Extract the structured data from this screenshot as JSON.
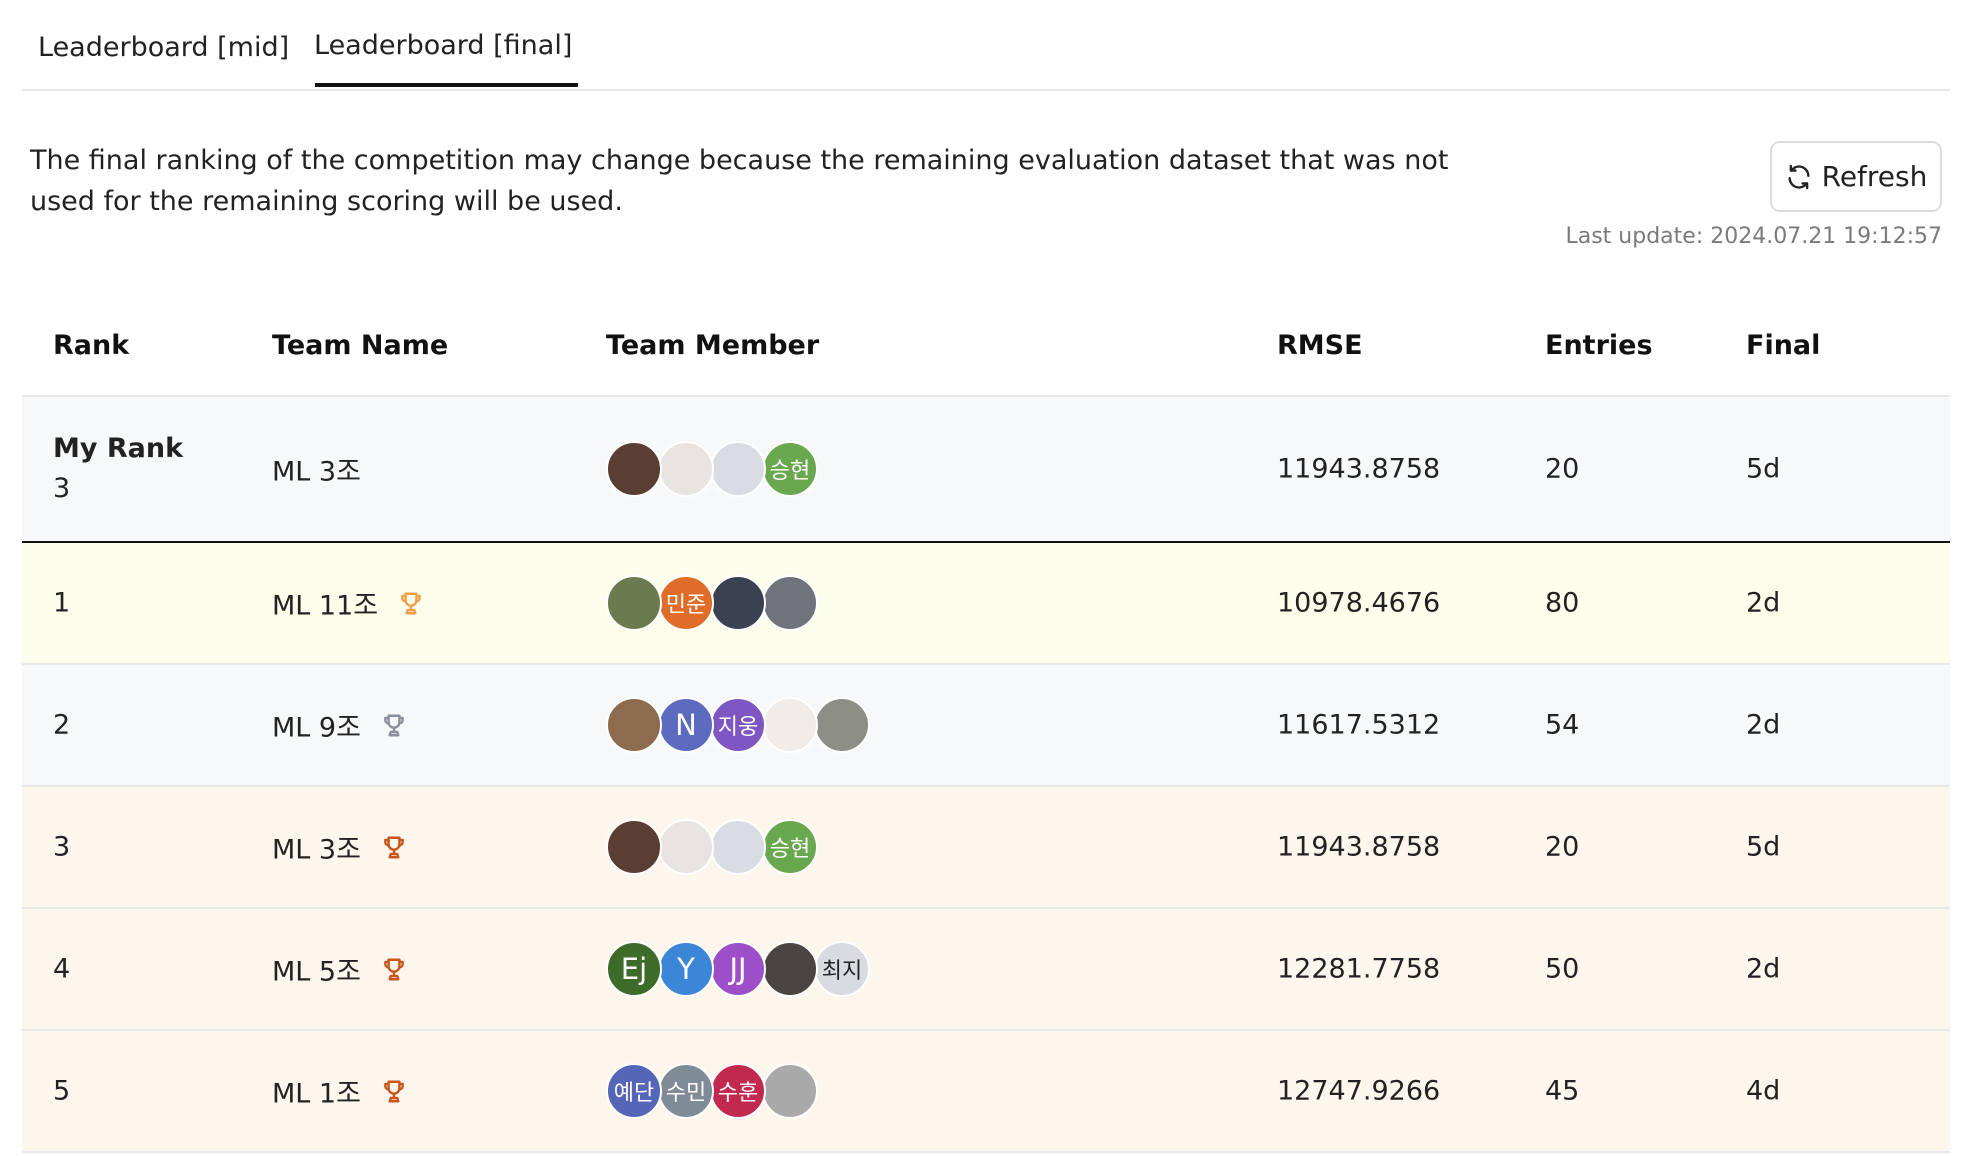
{
  "tabs": [
    {
      "label": "Leaderboard [mid]",
      "active": false
    },
    {
      "label": "Leaderboard [final]",
      "active": true
    }
  ],
  "notice": "The final ranking of the competition may change because the remaining evaluation dataset that was not used for the remaining scoring will be used.",
  "refresh_label": "Refresh",
  "last_update": "Last update: 2024.07.21 19:12:57",
  "table": {
    "headers": [
      "Rank",
      "Team Name",
      "Team Member",
      "RMSE",
      "Entries",
      "Final"
    ],
    "my_rank": {
      "label": "My Rank",
      "rank": "3",
      "team": "ML 3조",
      "rmse": "11943.8758",
      "entries": "20",
      "final": "5d",
      "members": [
        {
          "text": "",
          "color": "#5a3d33",
          "icon": "photo-avatar"
        },
        {
          "text": "",
          "color": "#e8e4e0",
          "icon": "photo-avatar"
        },
        {
          "text": "",
          "color": "#d9dde3",
          "icon": "photo-avatar"
        },
        {
          "text": "승현",
          "color": "#6aa84f"
        }
      ]
    },
    "rows": [
      {
        "rank": "1",
        "team": "ML 11조",
        "trophy_color": "#f0a04b",
        "rmse": "10978.4676",
        "entries": "80",
        "final": "2d",
        "tone": "gold",
        "members": [
          {
            "text": "",
            "color": "#6b7a4f",
            "icon": "photo-avatar"
          },
          {
            "text": "민준",
            "color": "#e06c2a"
          },
          {
            "text": "",
            "color": "#3a4150",
            "icon": "photo-avatar"
          },
          {
            "text": "",
            "color": "#6f747a",
            "icon": "photo-avatar"
          }
        ]
      },
      {
        "rank": "2",
        "team": "ML 9조",
        "trophy_color": "#8a9099",
        "rmse": "11617.5312",
        "entries": "54",
        "final": "2d",
        "tone": "silver",
        "members": [
          {
            "text": "",
            "color": "#8c6b4f",
            "icon": "photo-avatar"
          },
          {
            "text": "N",
            "color": "#5c6bc0",
            "big": true
          },
          {
            "text": "지웅",
            "color": "#7e57c2"
          },
          {
            "text": "",
            "color": "#f1ece8",
            "icon": "photo-avatar"
          },
          {
            "text": "",
            "color": "#8d8f86",
            "icon": "photo-avatar"
          }
        ]
      },
      {
        "rank": "3",
        "team": "ML 3조",
        "trophy_color": "#c8551b",
        "rmse": "11943.8758",
        "entries": "20",
        "final": "5d",
        "tone": "bronze",
        "members": [
          {
            "text": "",
            "color": "#5a3d33",
            "icon": "photo-avatar"
          },
          {
            "text": "",
            "color": "#e8e4e0",
            "icon": "photo-avatar"
          },
          {
            "text": "",
            "color": "#d9dde3",
            "icon": "photo-avatar"
          },
          {
            "text": "승현",
            "color": "#6aa84f"
          }
        ]
      },
      {
        "rank": "4",
        "team": "ML 5조",
        "trophy_color": "#c8551b",
        "rmse": "12281.7758",
        "entries": "50",
        "final": "2d",
        "tone": "bronze",
        "members": [
          {
            "text": "Ej",
            "color": "#3d6b2a",
            "big": true
          },
          {
            "text": "Y",
            "color": "#3b86d6",
            "big": true
          },
          {
            "text": "JJ",
            "color": "#9c4fc7",
            "big": true
          },
          {
            "text": "",
            "color": "#4a4540",
            "icon": "photo-avatar"
          },
          {
            "text": "최지",
            "color": "#d8dbe0",
            "dark": true
          }
        ]
      },
      {
        "rank": "5",
        "team": "ML 1조",
        "trophy_color": "#c8551b",
        "rmse": "12747.9266",
        "entries": "45",
        "final": "4d",
        "tone": "bronze",
        "members": [
          {
            "text": "예단",
            "color": "#5566b8"
          },
          {
            "text": "수민",
            "color": "#7f8c97"
          },
          {
            "text": "수훈",
            "color": "#c2294f"
          },
          {
            "text": "",
            "color": "#a9a9a9",
            "icon": "photo-avatar"
          }
        ]
      }
    ]
  }
}
